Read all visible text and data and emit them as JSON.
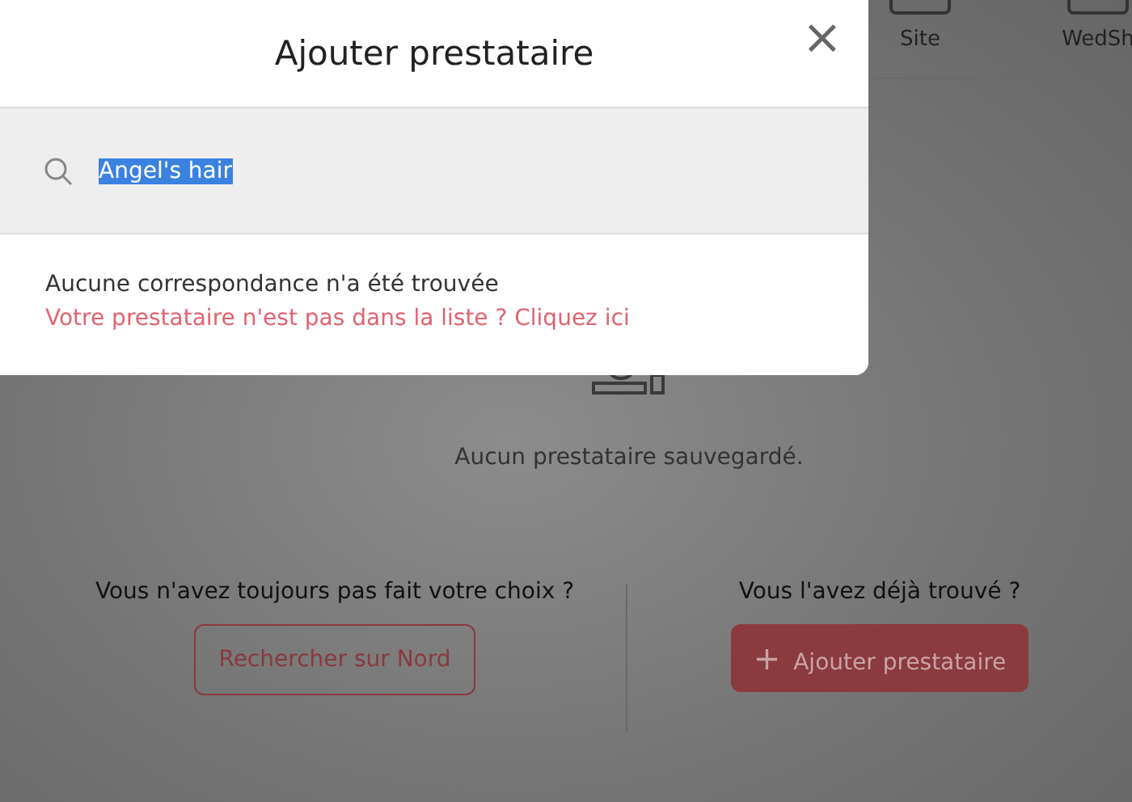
{
  "nav": {
    "items": [
      {
        "label": "Site"
      },
      {
        "label": "WedSh"
      }
    ]
  },
  "empty_state": {
    "message": "Aucun prestataire sauvegardé."
  },
  "choices": [
    {
      "question": "Vous n'avez toujours pas fait votre choix ?",
      "button": "Rechercher sur Nord",
      "kind": "outline"
    },
    {
      "question": "Vous l'avez déjà trouvé ?",
      "button": "Ajouter prestataire",
      "kind": "filled",
      "icon": "+"
    }
  ],
  "modal": {
    "title": "Ajouter prestataire",
    "close": "×",
    "search": {
      "value": "Angel's hair",
      "selected": true
    },
    "no_result": "Aucune correspondance n'a été trouvée",
    "link": "Votre prestataire n'est pas dans la liste ? Cliquez ici"
  }
}
